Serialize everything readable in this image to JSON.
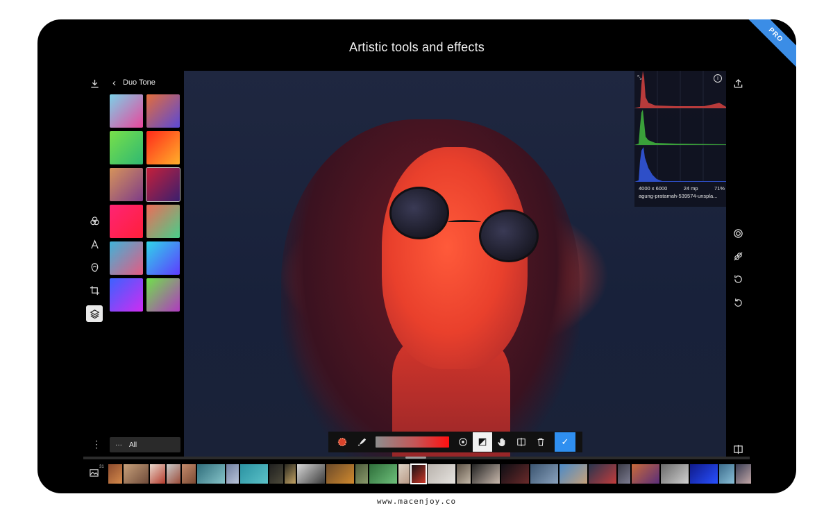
{
  "headline": "Artistic tools and effects",
  "pro_badge": "PRO",
  "panel": {
    "title": "Duo Tone",
    "swatches": [
      {
        "from": "#7bd1e8",
        "to": "#e9469b"
      },
      {
        "from": "#e36d3b",
        "to": "#5a49d6"
      },
      {
        "from": "#78e04a",
        "to": "#2fb872"
      },
      {
        "from": "#ff2a1b",
        "to": "#ffb02a"
      },
      {
        "from": "#d6935a",
        "to": "#7e3c88"
      },
      {
        "from": "#c51f3a",
        "to": "#3a1f6e",
        "selected": true
      },
      {
        "from": "#ff2474",
        "to": "#ff1f3a"
      },
      {
        "from": "#ee6b58",
        "to": "#48cf8a"
      },
      {
        "from": "#3fb3d8",
        "to": "#e65a82"
      },
      {
        "from": "#2fd5e9",
        "to": "#5e3cff"
      },
      {
        "from": "#3b62ff",
        "to": "#cf2cf1"
      },
      {
        "from": "#6fe14a",
        "to": "#b03ac0"
      }
    ]
  },
  "filter_bar": {
    "dots": "···",
    "label": "All"
  },
  "histogram": {
    "dimensions": "4000 x 6000",
    "megapixels": "24 mp",
    "zoom": "71%",
    "filename": "agung-pratamah-539574-unspla..."
  },
  "gallery": {
    "count": "31"
  },
  "toolbar": {
    "confirm": "✓"
  },
  "watermark": "www.macenjoy.co",
  "colors": {
    "accent": "#2f8ff0",
    "pro": "#3b8de6"
  },
  "filmstrip": [
    {
      "w": 20,
      "c1": "#8b4a2d",
      "c2": "#d58a4b"
    },
    {
      "w": 36,
      "c1": "#c7a07a",
      "c2": "#6f4b3a"
    },
    {
      "w": 22,
      "c1": "#e8d8cc",
      "c2": "#b43a2b"
    },
    {
      "w": 20,
      "c1": "#c8c9c9",
      "c2": "#9c4d3a"
    },
    {
      "w": 20,
      "c1": "#c48b6c",
      "c2": "#7c4a33"
    },
    {
      "w": 40,
      "c1": "#2f6d7b",
      "c2": "#86c4c9"
    },
    {
      "w": 18,
      "c1": "#6f7fa0",
      "c2": "#b9c4d9"
    },
    {
      "w": 40,
      "c1": "#2a92a2",
      "c2": "#5cc2c8"
    },
    {
      "w": 20,
      "c1": "#1f1f1f",
      "c2": "#4d4a3a"
    },
    {
      "w": 16,
      "c1": "#2c2a21",
      "c2": "#c2a264"
    },
    {
      "w": 40,
      "c1": "#d7d7d7",
      "c2": "#3b3b3b"
    },
    {
      "w": 40,
      "c1": "#6b4a2a",
      "c2": "#d0892e"
    },
    {
      "w": 18,
      "c1": "#4b5a3a",
      "c2": "#8a9a6b"
    },
    {
      "w": 40,
      "c1": "#2e6e3a",
      "c2": "#6ec07b"
    },
    {
      "w": 16,
      "c1": "#ded4c7",
      "c2": "#b99a86"
    },
    {
      "w": 22,
      "c1": "#0e0e12",
      "c2": "#d33a2a",
      "current": true
    },
    {
      "w": 40,
      "c1": "#b8b2ac",
      "c2": "#e6e3df"
    },
    {
      "w": 20,
      "c1": "#5b5044",
      "c2": "#c4b8a8"
    },
    {
      "w": 40,
      "c1": "#222",
      "c2": "#c9b9ad"
    },
    {
      "w": 40,
      "c1": "#0e0e14",
      "c2": "#6a2a2a"
    },
    {
      "w": 40,
      "c1": "#3a5470",
      "c2": "#8aa2bd"
    },
    {
      "w": 40,
      "c1": "#4a8ac8",
      "c2": "#c7a17a"
    },
    {
      "w": 40,
      "c1": "#28354e",
      "c2": "#c23c3c"
    },
    {
      "w": 18,
      "c1": "#3a3a46",
      "c2": "#7c7c90"
    },
    {
      "w": 40,
      "c1": "#c86a3a",
      "c2": "#5a2e7a"
    },
    {
      "w": 40,
      "c1": "#6a6a6a",
      "c2": "#d0d0d0"
    },
    {
      "w": 40,
      "c1": "#0f1a8a",
      "c2": "#2850ff"
    },
    {
      "w": 22,
      "c1": "#3a6a8a",
      "c2": "#8ac0d8"
    },
    {
      "w": 22,
      "c1": "#3a3e55",
      "c2": "#c2a7a7"
    }
  ]
}
